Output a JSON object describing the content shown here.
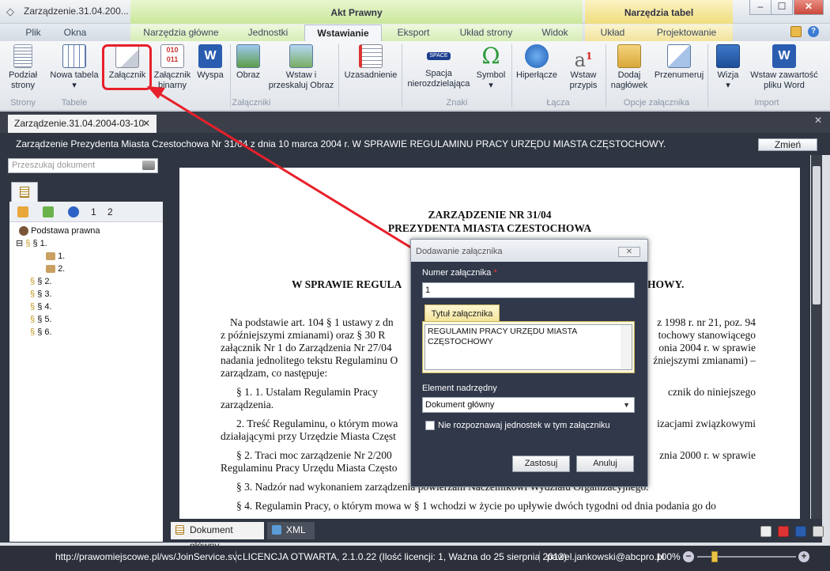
{
  "window": {
    "title": "Zarządzenie.31.04.200...",
    "context_akt": "Akt Prawny",
    "context_tabele": "Narzędzia tabel",
    "min": "–",
    "max": "☐",
    "close": "✕"
  },
  "tabs": [
    "Plik",
    "Okna",
    "Narzędzia główne",
    "Jednostki",
    "Wstawianie",
    "Eksport",
    "Układ strony",
    "Widok",
    "Układ",
    "Projektowanie"
  ],
  "ribbon": {
    "podzial": "Podział strony",
    "nowa_tabela": "Nowa tabela",
    "zalacznik": "Załącznik",
    "zalacznik_binarny": "Załącznik binarny",
    "wyspa": "Wyspa",
    "obraz": "Obraz",
    "wstaw_przeskaluj": "Wstaw i przeskaluj Obraz",
    "uzasadnienie": "Uzasadnienie",
    "spacja": "Spacja nierozdzielająca",
    "symbol": "Symbol",
    "hiperlacze": "Hiperłącze",
    "wstaw_przypis": "Wstaw przypis",
    "dodaj_naglowek": "Dodaj nagłówek",
    "przenumeruj": "Przenumeruj",
    "wizja": "Wizja",
    "wstaw_word": "Wstaw zawartość pliku Word",
    "groups": {
      "strony": "Strony",
      "tabele": "Tabele",
      "zalaczniki": "Załączniki",
      "znaki": "Znaki",
      "lacza": "Łącza",
      "opcje": "Opcje załącznika",
      "import": "Import"
    },
    "przypis_badge": "1"
  },
  "doc_tab": {
    "label": "Zarządzenie.31.04.2004-03-10",
    "close": "✕"
  },
  "infobar": {
    "text": "Zarządzenie Prezydenta Miasta Czestochowa Nr 31/04 z dnia 10 marca 2004 r. W SPRAWIE REGULAMINU PRACY URZĘDU MIASTA CZĘSTOCHOWY.",
    "button": "Zmień",
    "panel_close": "✕"
  },
  "search": {
    "placeholder": "Przeszukaj dokument"
  },
  "tree": {
    "level1": "1",
    "level2": "2",
    "nodes": [
      "Podstawa prawna",
      "§ 1.",
      "1.",
      "2.",
      "§ 2.",
      "§ 3.",
      "§ 4.",
      "§ 5.",
      "§ 6."
    ]
  },
  "document": {
    "title1": "ZARZĄDZENIE NR 31/04",
    "title2": "PREZYDENTA MIASTA CZESTOCHOWA",
    "heading_left": "W SPRAWIE REGULA",
    "heading_right": "HOWY.",
    "lines": [
      {
        "l": "Na podstawie art. 104 § 1 ustawy z dn",
        "r": "z 1998 r. nr 21, poz. 94"
      },
      {
        "l": "z późniejszymi zmianami) oraz § 30 R",
        "r": "tochowy stanowiącego"
      },
      {
        "l": "załącznik Nr 1 do Zarządzenia Nr 27/04",
        "r": "onia 2004 r. w sprawie"
      },
      {
        "l": "nadania jednolitego tekstu Regulaminu O",
        "r": "źniejszymi zmianami) –"
      },
      {
        "l": "zarządzam, co następuje:",
        "r": ""
      },
      {
        "l": "§ 1. 1. Ustalam Regulamin Pracy",
        "r": "cznik do niniejszego"
      },
      {
        "l": "zarządzenia.",
        "r": ""
      },
      {
        "l": "2. Treść Regulaminu, o którym mowa",
        "r": "izacjami związkowymi"
      },
      {
        "l": "działającymi przy Urzędzie Miasta Częst",
        "r": ""
      },
      {
        "l": "§ 2. Traci moc zarządzenie Nr 2/200",
        "r": "znia 2000 r. w sprawie"
      },
      {
        "l": "Regulaminu Pracy Urzędu Miasta Często",
        "r": ""
      },
      {
        "l": "§ 3. Nadzór nad wykonaniem zarządzenia powierzam Naczelnikowi Wydziału Organizacyjnego.",
        "r": ""
      },
      {
        "l": "§ 4. Regulamin Pracy, o którym mowa w § 1 wchodzi w życie po upływie dwóch tygodni od dnia podania go do",
        "r": ""
      }
    ]
  },
  "dialog": {
    "title": "Dodawanie załącznika",
    "close": "✕",
    "numer_label": "Numer załącznika",
    "required": "*",
    "numer_value": "1",
    "tytul_tab": "Tytuł załącznika",
    "tytul_value": "REGULAMIN PRACY URZĘDU MIASTA CZĘSTOCHOWY",
    "element_label": "Element nadrzędny",
    "element_value": "Dokument główny",
    "checkbox_label": "Nie rozpoznawaj jednostek w tym załączniku",
    "zastosuj": "Zastosuj",
    "anuluj": "Anuluj"
  },
  "bottom_tabs": {
    "main": "Dokument główny",
    "xml": "XML"
  },
  "status": {
    "url": "http://prawomiejscowe.pl/ws/JoinService.svc",
    "licencja": "LICENCJA OTWARTA, 2.1.0.22 (Ilość licencji: 1, Ważna do 25 sierpnia 2012)",
    "user": "pawel.jankowski@abcpro.pl",
    "zoom": "100%",
    "zoom_minus": "−",
    "zoom_plus": "+"
  },
  "colors": {
    "highlight_red": "#e8202a",
    "dark_panel": "#2f3541"
  }
}
